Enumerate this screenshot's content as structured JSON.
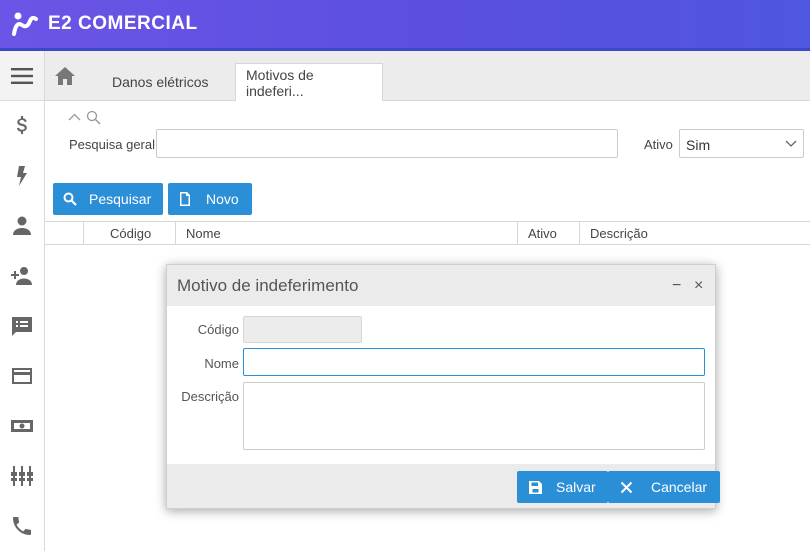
{
  "app": {
    "brand": "E2 COMERCIAL"
  },
  "sidebar": {
    "items": [
      {
        "icon": "dollar-icon"
      },
      {
        "icon": "lightning-icon"
      },
      {
        "icon": "person-icon"
      },
      {
        "icon": "add-person-icon"
      },
      {
        "icon": "chat-list-icon"
      },
      {
        "icon": "credit-card-icon"
      },
      {
        "icon": "cash-icon"
      },
      {
        "icon": "tower-icon"
      },
      {
        "icon": "phone-icon"
      }
    ]
  },
  "tabs": [
    {
      "label": "Danos elétricos"
    },
    {
      "label": "Motivos de indeferi..."
    }
  ],
  "search": {
    "general_label": "Pesquisa geral",
    "general_value": "",
    "active_label": "Ativo",
    "active_value": "Sim",
    "search_button": "Pesquisar",
    "new_button": "Novo"
  },
  "grid": {
    "columns": [
      "Código",
      "Nome",
      "Ativo",
      "Descrição"
    ]
  },
  "modal": {
    "title": "Motivo de indeferimento",
    "code_label": "Código",
    "code_value": "",
    "name_label": "Nome",
    "name_value": "",
    "description_label": "Descrição",
    "description_value": "",
    "save_button": "Salvar",
    "cancel_button": "Cancelar",
    "minimize_glyph": "−",
    "close_glyph": "×"
  },
  "colors": {
    "accent": "#2b8fd8",
    "header": "#5b4fe0"
  }
}
